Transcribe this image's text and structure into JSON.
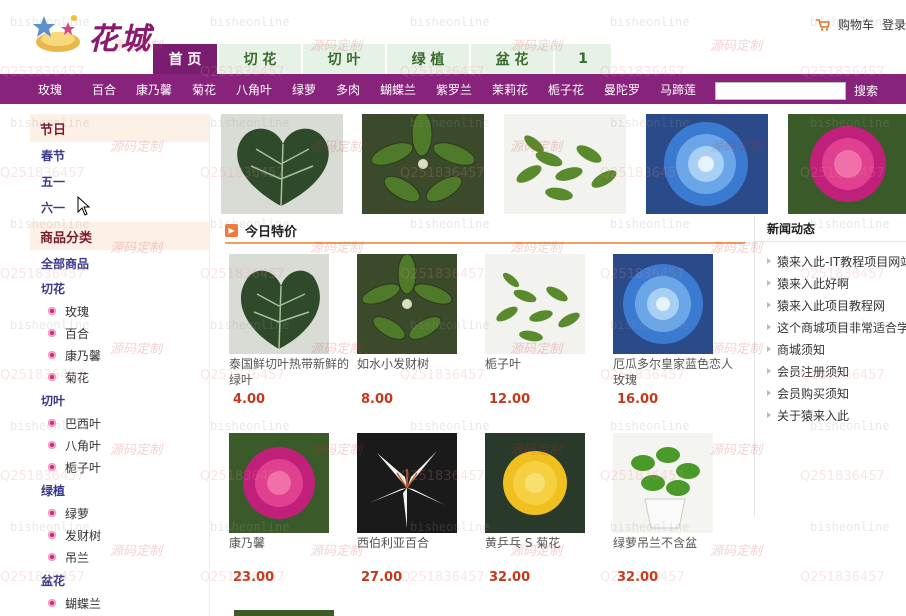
{
  "header": {
    "logo_text": "花城",
    "cart_label": "购物车",
    "login_label": "登录"
  },
  "nav": {
    "tabs": [
      {
        "label": "首 页",
        "active": true
      },
      {
        "label": "切 花",
        "active": false
      },
      {
        "label": "切 叶",
        "active": false
      },
      {
        "label": "绿 植",
        "active": false
      },
      {
        "label": "盆 花",
        "active": false
      },
      {
        "label": "1",
        "active": false
      }
    ]
  },
  "category_bar": {
    "links": [
      "玫瑰",
      "百合",
      "康乃馨",
      "菊花",
      "八角叶",
      "绿萝",
      "多肉",
      "蝴蝶兰",
      "紫罗兰",
      "茉莉花",
      "栀子花",
      "曼陀罗",
      "马蹄莲"
    ],
    "search_value": "",
    "search_button": "搜索"
  },
  "sidebar": {
    "festival_head": "节日",
    "festivals": [
      "春节",
      "五一",
      "六一"
    ],
    "category_head": "商品分类",
    "all_label": "全部商品",
    "groups": [
      {
        "name": "切花",
        "items": [
          "玫瑰",
          "百合",
          "康乃馨",
          "菊花"
        ]
      },
      {
        "name": "切叶",
        "items": [
          "巴西叶",
          "八角叶",
          "栀子叶"
        ]
      },
      {
        "name": "绿植",
        "items": [
          "绿萝",
          "发财树",
          "吊兰"
        ]
      },
      {
        "name": "盆花",
        "items": [
          "蝴蝶兰"
        ]
      }
    ]
  },
  "special": {
    "title": "今日特价",
    "products": [
      {
        "name": "泰国鲜切叶热带新鲜的绿叶",
        "price": "4.00"
      },
      {
        "name": "如水小发财树",
        "price": "8.00"
      },
      {
        "name": "栀子叶",
        "price": "12.00"
      },
      {
        "name": "厄瓜多尔皇家蓝色恋人玫瑰",
        "price": "16.00"
      },
      {
        "name": "康乃馨",
        "price": "23.00"
      },
      {
        "name": "西伯利亚百合",
        "price": "27.00"
      },
      {
        "name": "黄乒乓 S 菊花",
        "price": "32.00"
      },
      {
        "name": "绿萝吊兰不含盆",
        "price": "32.00"
      }
    ]
  },
  "news": {
    "title": "新闻动态",
    "items": [
      "猿来入此-IT教程项目网站",
      "猿来入此好啊",
      "猿来入此项目教程网",
      "这个商城项目非常适合学习",
      "商城须知",
      "会员注册须知",
      "会员购买须知",
      "关于猿来入此"
    ]
  },
  "colors": {
    "brand": "#87237a",
    "price": "#c0391a",
    "nav_green": "#3b6b2e"
  }
}
